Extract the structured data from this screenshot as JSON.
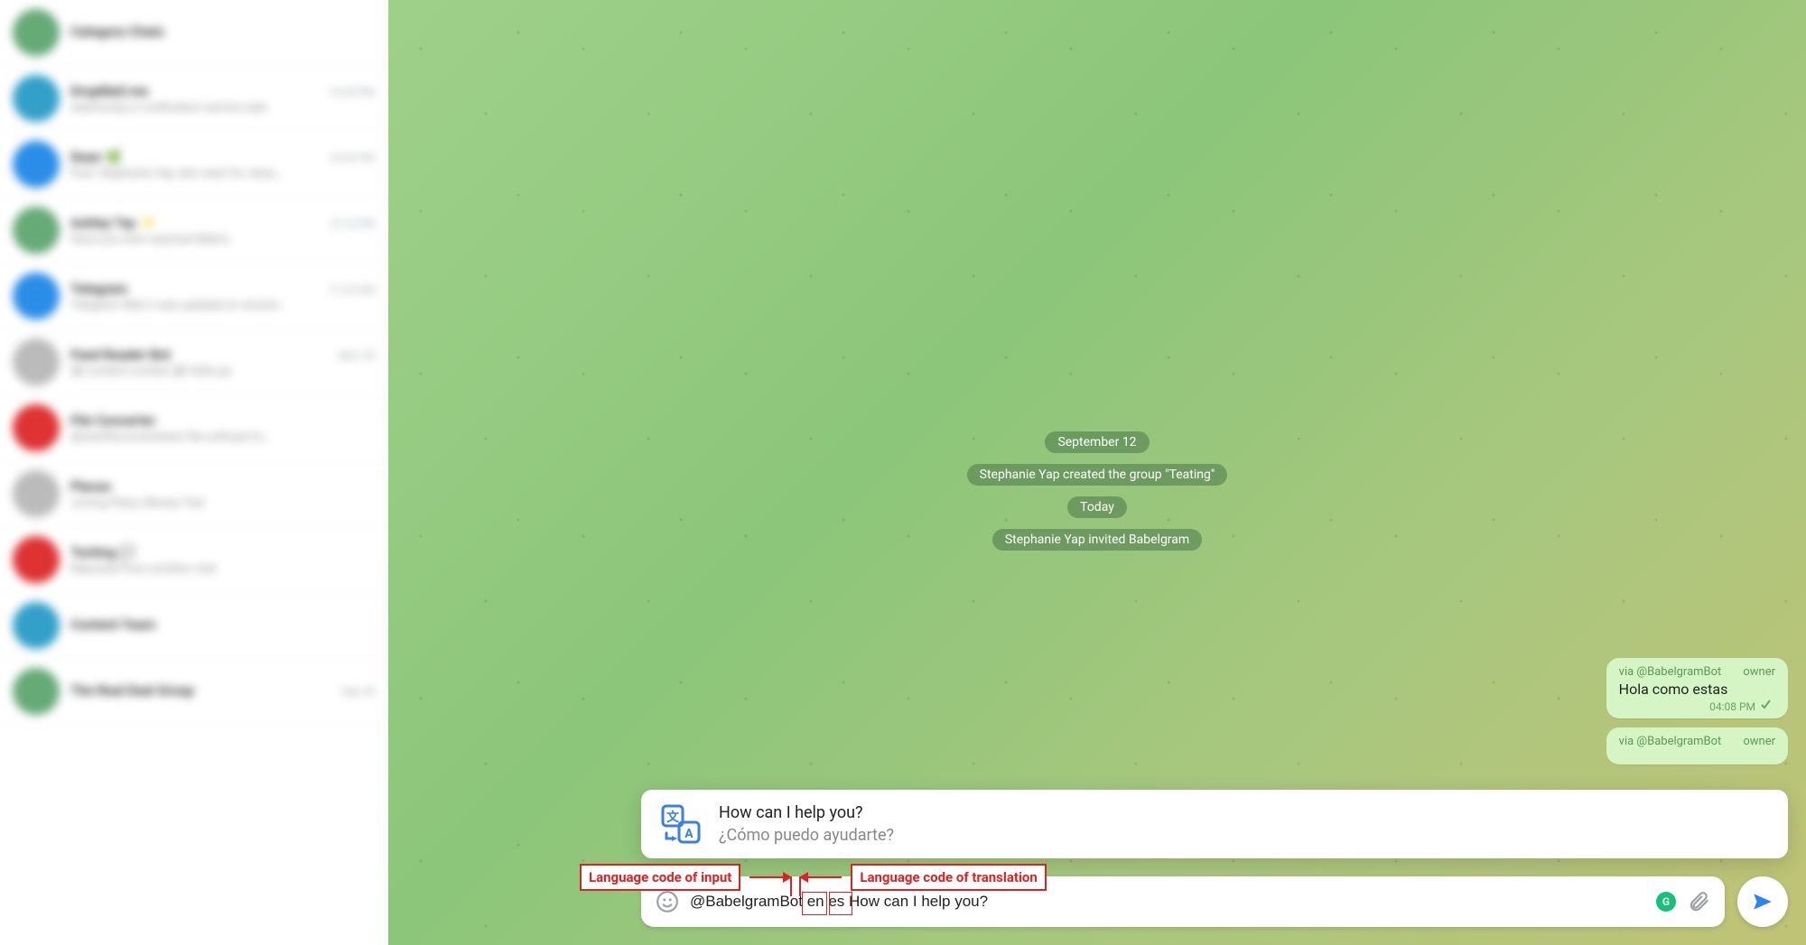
{
  "sidebar": {
    "chats": [
      {
        "name": "Category Chats",
        "preview": "",
        "time": ""
      },
      {
        "name": "DropMail.me",
        "preview": "webmoney.ru notification service sale",
        "time": "10:54 PM"
      },
      {
        "name": "Dean 🌿",
        "preview": "Psst: Stephanie Yap, let's start for class…",
        "time": "10:50 PM"
      },
      {
        "name": "Ashley Tay ✨",
        "preview": "Have you even watched Matrix",
        "time": "12:16 PM"
      },
      {
        "name": "Telegram",
        "preview": "Telegram Web 2 was updated to version…",
        "time": "11:33 AM"
      },
      {
        "name": "Feed Reader Bot",
        "preview": "📰 content.context 📰 hello.pa",
        "time": "Mon 30"
      },
      {
        "name": "File Converter",
        "preview": "@newfileconverterbot file softcard to…",
        "time": ""
      },
      {
        "name": "Places",
        "preview": "Jurong Plaza, Money Tree",
        "time": ""
      },
      {
        "name": "Testing 💬",
        "preview": "Reposted from another chat",
        "time": ""
      },
      {
        "name": "Content Team",
        "preview": "",
        "time": ""
      },
      {
        "name": "The Real Deal Group",
        "preview": "",
        "time": "Sep 28"
      }
    ]
  },
  "chat": {
    "date1": "September 12",
    "system1": "Stephanie Yap created the group \"Teating\"",
    "date2": "Today",
    "system2": "Stephanie Yap invited Babelgram",
    "bubbles": [
      {
        "via": "via @BabelgramBot",
        "role": "owner",
        "text": "Hola como estas",
        "time": "04:08 PM"
      },
      {
        "via": "via @BabelgramBot",
        "role": "owner",
        "text": "",
        "time": ""
      }
    ]
  },
  "suggestion": {
    "main": "How can I help you?",
    "sub": "¿Cómo puedo ayudarte?"
  },
  "annotations": {
    "left": "Language code of input",
    "right": "Language code of translation"
  },
  "composer": {
    "value": "@BabelgramBot en es How can I help you?",
    "lang_in": "en",
    "lang_out": "es"
  }
}
